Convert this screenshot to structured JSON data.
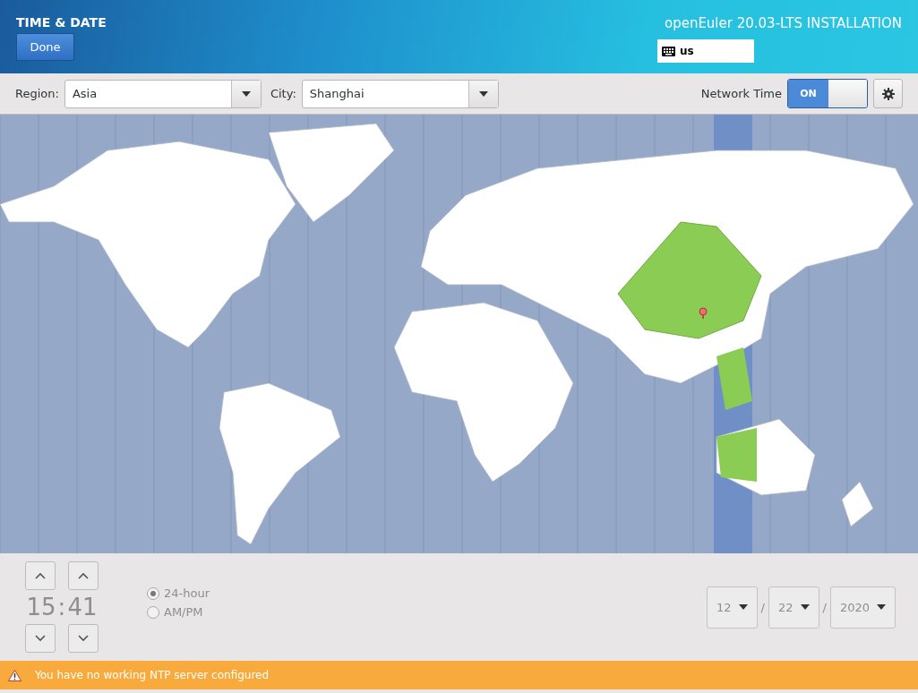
{
  "header": {
    "title": "TIME & DATE",
    "done_button": "Done",
    "product": "openEuler 20.03-LTS INSTALLATION",
    "keyboard_layout": "us"
  },
  "toolbar": {
    "region_label": "Region:",
    "region": "Asia",
    "city_label": "City:",
    "city": "Shanghai",
    "network_time_label": "Network Time",
    "network_time": {
      "label": "ON",
      "on": true
    }
  },
  "time": {
    "hours": "15",
    "separator": ":",
    "minutes": "41",
    "disabled": true
  },
  "format_options": [
    {
      "label": "24-hour",
      "selected": true
    },
    {
      "label": "AM/PM",
      "selected": false
    }
  ],
  "date": {
    "fields": [
      "12",
      "22",
      "2020"
    ],
    "separators": [
      "/",
      "/"
    ]
  },
  "warning": "You have no working NTP server configured"
}
